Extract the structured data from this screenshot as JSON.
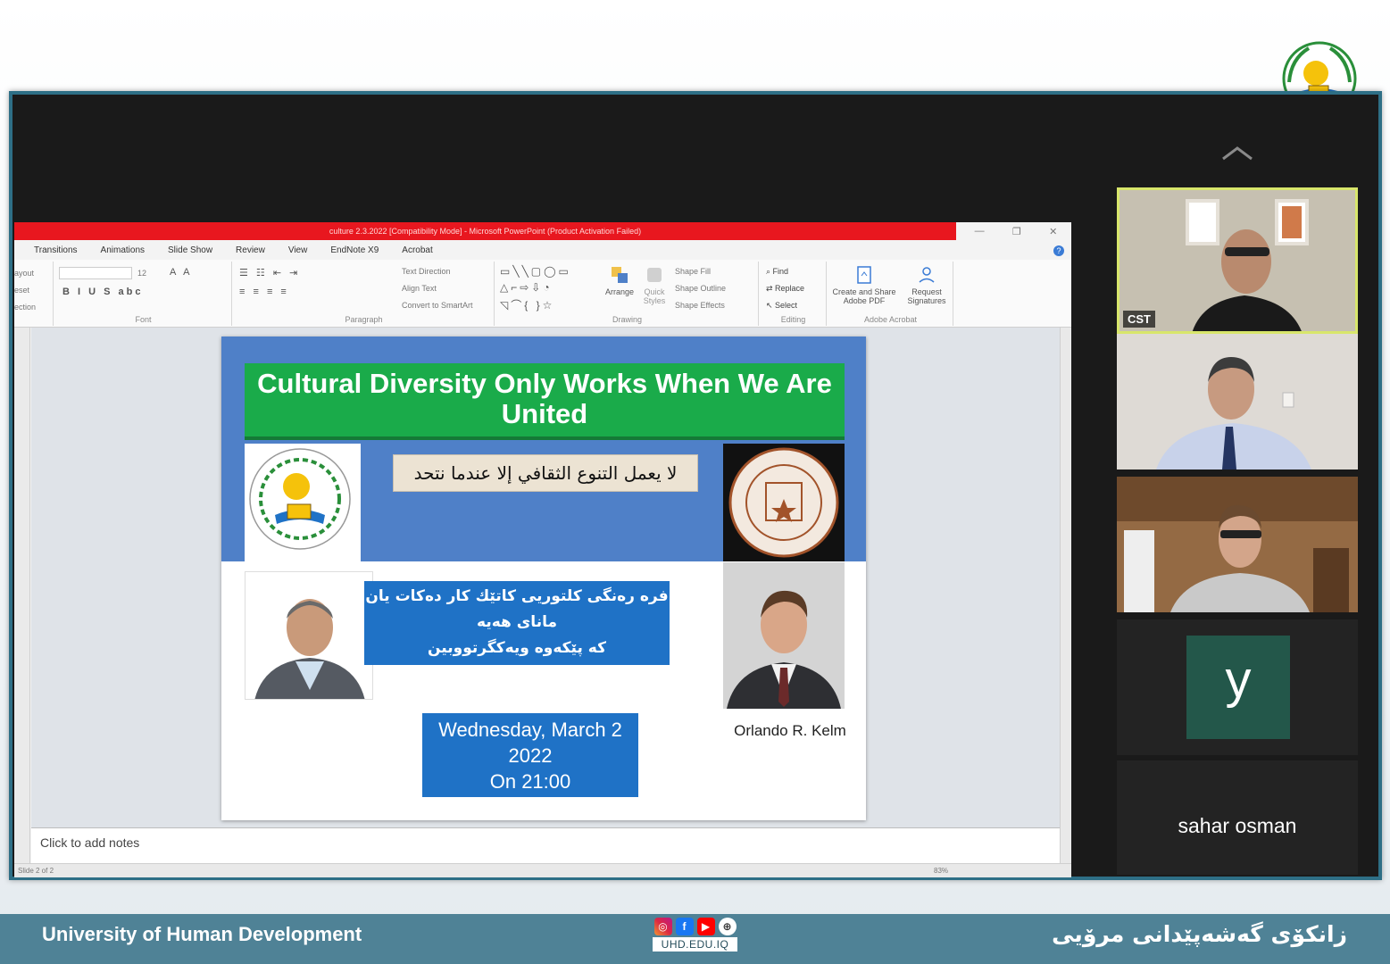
{
  "ppt": {
    "title": "culture 2.3.2022 [Compatibility Mode] - Microsoft PowerPoint (Product Activation Failed)",
    "menu": [
      "Transitions",
      "Animations",
      "Slide Show",
      "Review",
      "View",
      "EndNote X9",
      "Acrobat"
    ],
    "ribbon": {
      "clip_items": [
        "ayout",
        "eset",
        "ection"
      ],
      "font_label": "Font",
      "font_size": "12",
      "paragraph_label": "Paragraph",
      "text_direction": "Text Direction",
      "align_text": "Align Text",
      "convert_smartart": "Convert to SmartArt",
      "drawing_label": "Drawing",
      "arrange": "Arrange",
      "quick_styles": "Quick Styles",
      "shape_fill": "Shape Fill",
      "shape_outline": "Shape Outline",
      "shape_effects": "Shape Effects",
      "editing_label": "Editing",
      "find": "Find",
      "replace": "Replace",
      "select": "Select",
      "create_share_pdf": "Create and Share Adobe PDF",
      "request_signatures": "Request Signatures",
      "adobe_label": "Adobe Acrobat"
    },
    "notes_placeholder": "Click to add notes",
    "status_left": "Slide 2 of 2",
    "status_zoom": "83%"
  },
  "slide": {
    "title": "Cultural Diversity Only Works When We Are United",
    "arabic": "لا يعمل التنوع الثقافي إلا عندما نتحد",
    "kurdish_lines": [
      "فره رەنگی کلتوریی کاتێك کار دەکات یان",
      "مانای هەیە",
      "کە پێکەوە ویەکگرتووبین"
    ],
    "speaker": "Orlando R. Kelm",
    "date_lines": [
      "Wednesday, March 2",
      "2022",
      "On 21:00"
    ]
  },
  "participants": [
    {
      "name": "CST",
      "active": true
    },
    {
      "name": ""
    },
    {
      "name": ""
    },
    {
      "name": "",
      "avatar_letter": "y"
    },
    {
      "name": "sahar osman"
    }
  ],
  "footer": {
    "left": "University of Human Development",
    "right": "زانکۆی گەشەپێدانی مرۆیی",
    "url": "UHD.EDU.IQ",
    "social_icons": [
      "instagram-icon",
      "facebook-icon",
      "youtube-icon",
      "web-icon"
    ]
  },
  "colors": {
    "title_red": "#e8171f",
    "slide_green": "#1aab4a",
    "slide_blue": "#1f72c6",
    "band_blue": "#4f80c8",
    "footer_teal": "#4f8296",
    "active_speaker": "#d8e66b",
    "avatar_green": "#23574a"
  }
}
